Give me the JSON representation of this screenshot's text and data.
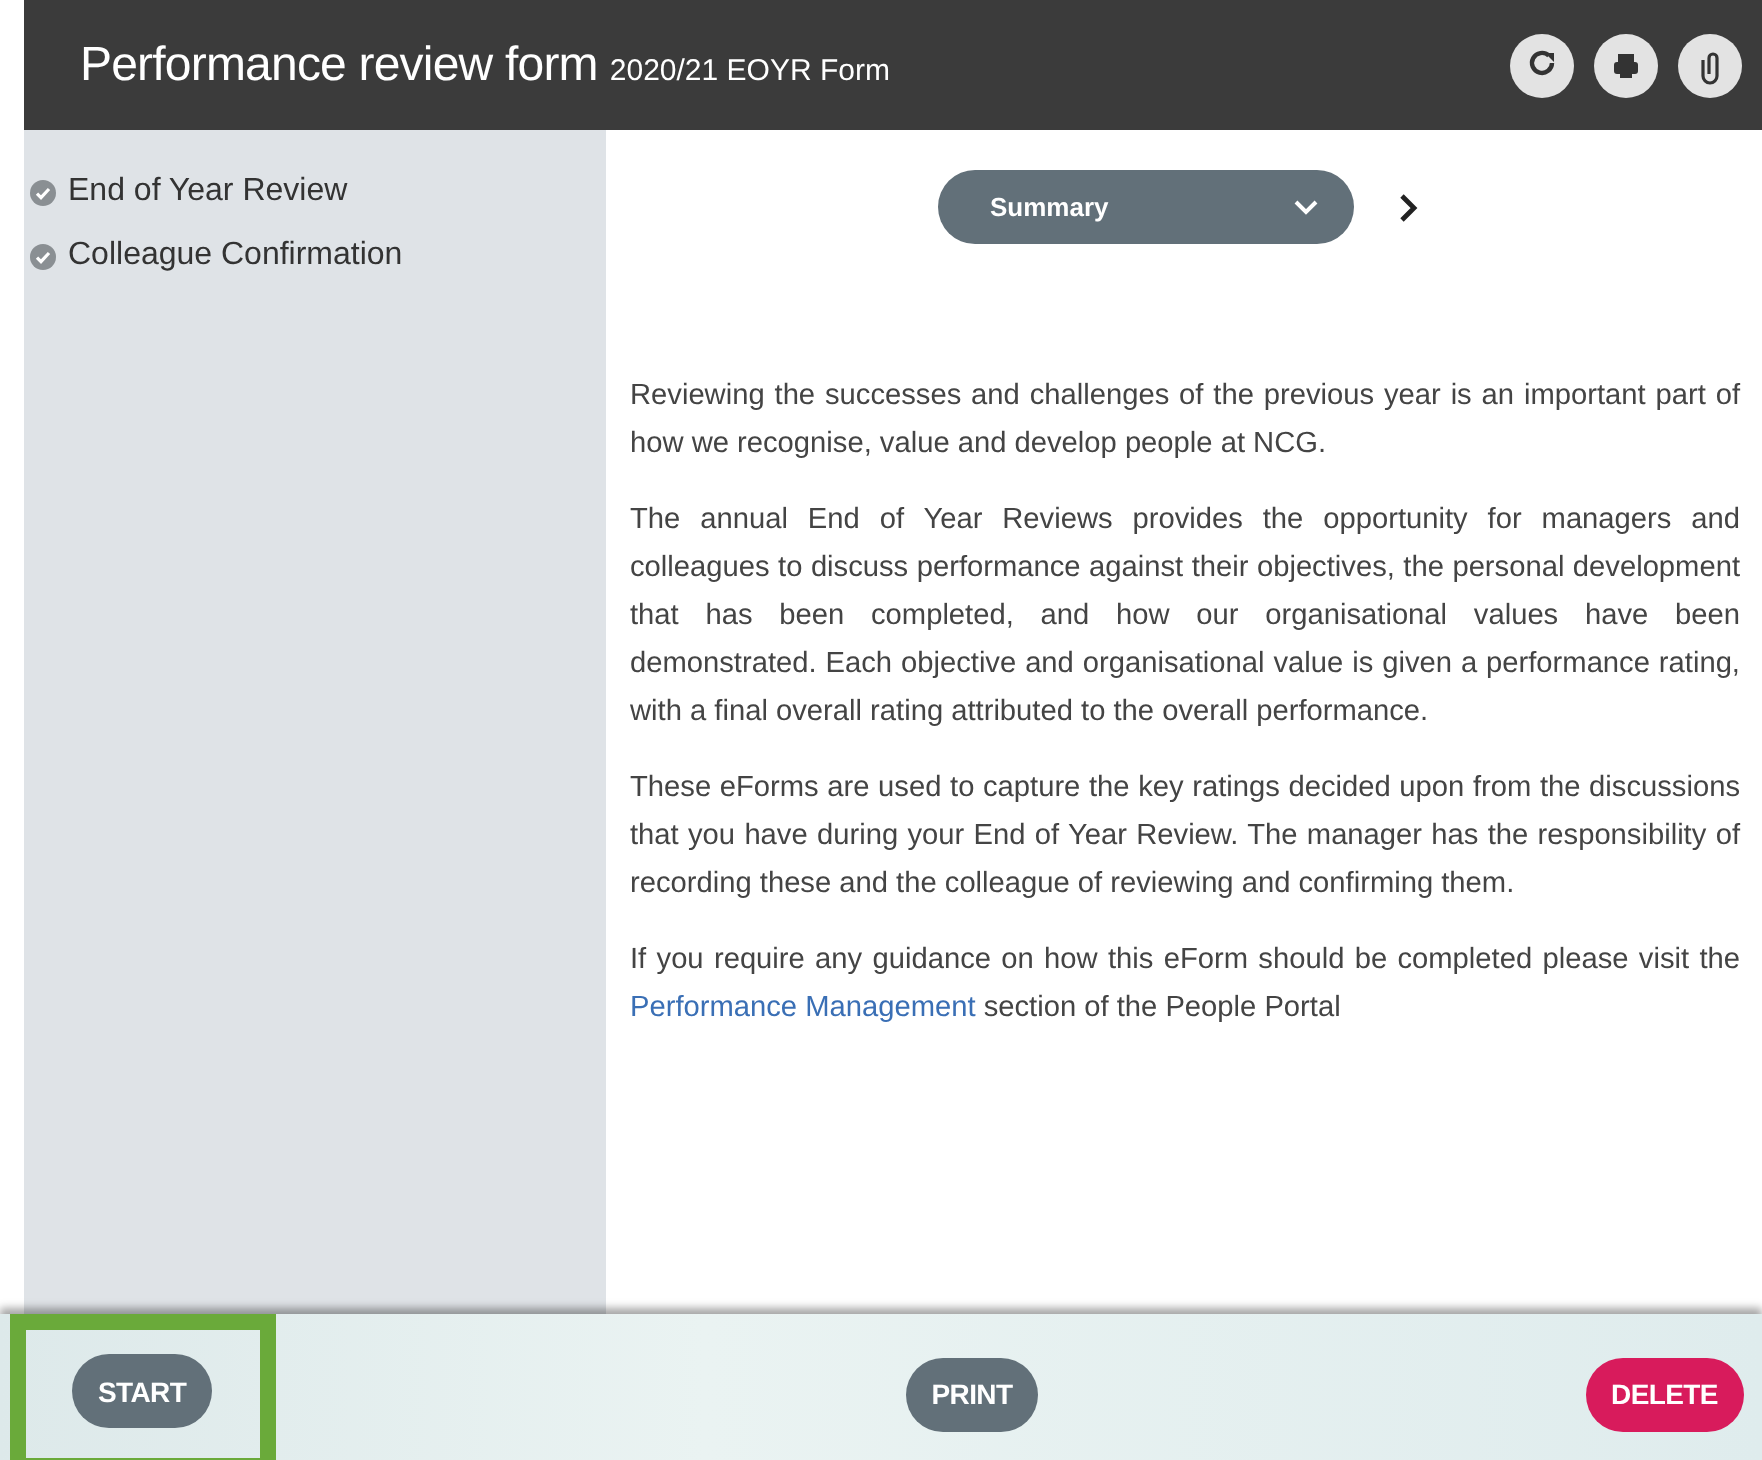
{
  "header": {
    "title": "Performance review form",
    "subtitle": "2020/21 EOYR Form",
    "icons": [
      {
        "kind": "refresh"
      },
      {
        "kind": "print"
      },
      {
        "kind": "attach"
      }
    ]
  },
  "sidebar": {
    "items": [
      {
        "label": "End of Year Review",
        "checked": true
      },
      {
        "label": "Colleague Confirmation",
        "checked": true
      }
    ]
  },
  "section_select": {
    "value": "Summary"
  },
  "paragraphs": [
    "Reviewing the successes and challenges of the previous year is an important part of how we recognise, value and develop people at NCG.",
    "The annual End of Year Reviews provides the opportunity for managers and colleagues to discuss performance against their objectives, the personal development that has been completed, and how our organisational values have been demonstrated. Each objective and organisational value is given a performance rating, with a final overall rating attributed to the overall performance.",
    "These eForms are used to capture the key ratings decided upon from the discussions that you have during your End of Year Review. The manager has the responsibility of recording these and the colleague of reviewing and confirming them."
  ],
  "guidance": {
    "before": "If you require any guidance on how this eForm should be completed please visit the",
    "link": "Performance Management",
    "after": "section of the People Portal"
  },
  "buttons": [
    {
      "label": "START",
      "kind": "neutral",
      "highlighted": true
    },
    {
      "label": "PRINT",
      "kind": "neutral",
      "highlighted": false
    },
    {
      "label": "DELETE",
      "kind": "danger",
      "highlighted": false
    }
  ]
}
